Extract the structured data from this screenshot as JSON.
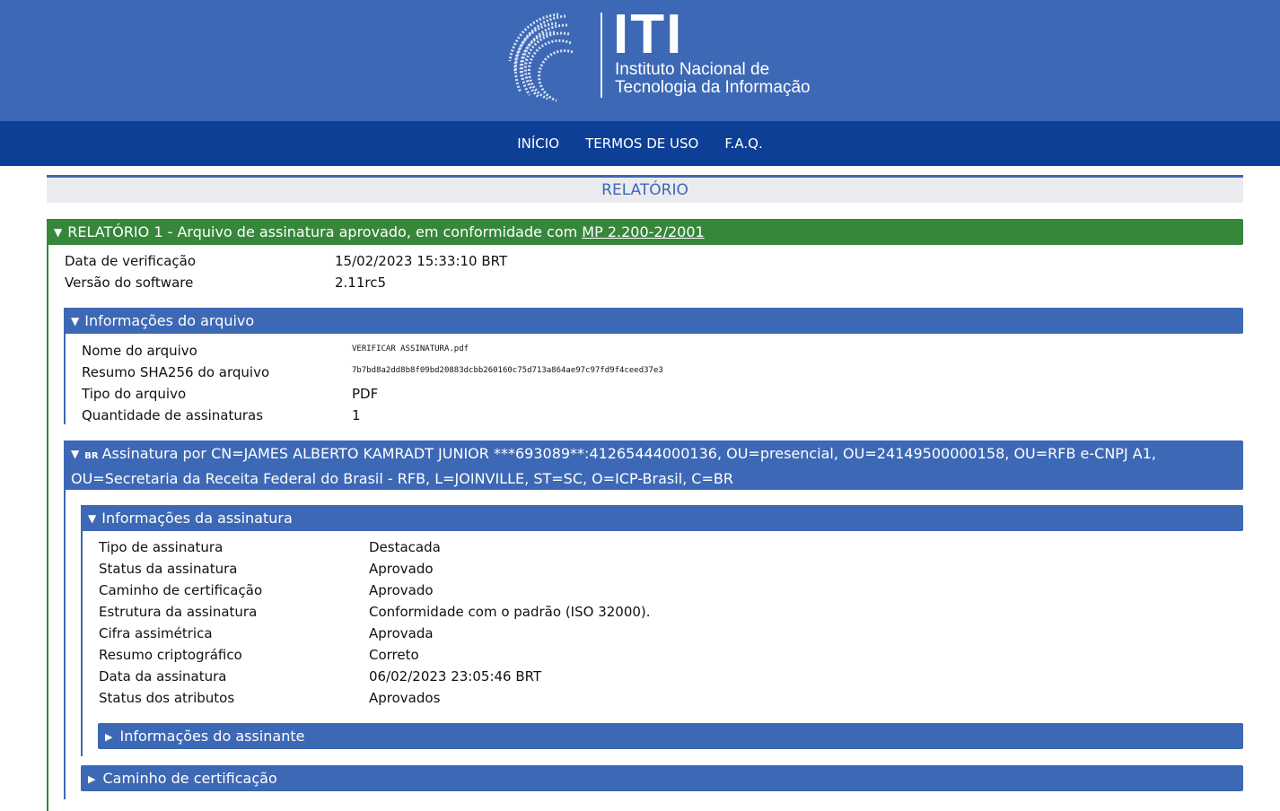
{
  "header": {
    "logo_text": "ITI",
    "logo_line1": "Instituto Nacional de",
    "logo_line2": "Tecnologia da Informação"
  },
  "nav": {
    "items": [
      "INÍCIO",
      "TERMOS DE USO",
      "F.A.Q."
    ]
  },
  "report": {
    "title": "RELATÓRIO",
    "section_title": "RELATÓRIO 1 - Arquivo de assinatura aprovado, em conformidade com",
    "section_link": "MP 2.200-2/2001",
    "rows": [
      {
        "label": "Data de verificação",
        "value": "15/02/2023 15:33:10 BRT"
      },
      {
        "label": "Versão do software",
        "value": "2.11rc5"
      }
    ]
  },
  "file_info": {
    "title": "Informações do arquivo",
    "rows": [
      {
        "label": "Nome do arquivo",
        "value": "VERIFICAR ASSINATURA.pdf"
      },
      {
        "label": "Resumo SHA256 do arquivo",
        "value": "7b7bd8a2dd8b8f09bd20883dcbb260160c75d713a864ae97c97fd9f4ceed37e3"
      },
      {
        "label": "Tipo do arquivo",
        "value": "PDF"
      },
      {
        "label": "Quantidade de assinaturas",
        "value": "1"
      }
    ]
  },
  "signature": {
    "country": "BR",
    "line1": "Assinatura por CN=JAMES ALBERTO KAMRADT JUNIOR ***693089**:41265444000136, OU=presencial, OU=24149500000158, OU=RFB e-CNPJ A1,",
    "line2": "OU=Secretaria da Receita Federal do Brasil - RFB, L=JOINVILLE, ST=SC, O=ICP-Brasil, C=BR"
  },
  "sig_info": {
    "title": "Informações da assinatura",
    "rows": [
      {
        "label": "Tipo de assinatura",
        "value": "Destacada"
      },
      {
        "label": "Status da assinatura",
        "value": "Aprovado"
      },
      {
        "label": "Caminho de certificação",
        "value": "Aprovado"
      },
      {
        "label": "Estrutura da assinatura",
        "value": "Conformidade com o padrão (ISO 32000)."
      },
      {
        "label": "Cifra assimétrica",
        "value": "Aprovada"
      },
      {
        "label": "Resumo criptográfico",
        "value": "Correto"
      },
      {
        "label": "Data da assinatura",
        "value": "06/02/2023 23:05:46 BRT"
      },
      {
        "label": "Status dos atributos",
        "value": "Aprovados"
      }
    ]
  },
  "signer_info": {
    "title": "Informações do assinante"
  },
  "cert_path": {
    "title": "Caminho de certificação"
  },
  "colors": {
    "header_blue": "#3d68b5",
    "nav_blue": "#0e3f96",
    "approved_green": "#36873a"
  }
}
